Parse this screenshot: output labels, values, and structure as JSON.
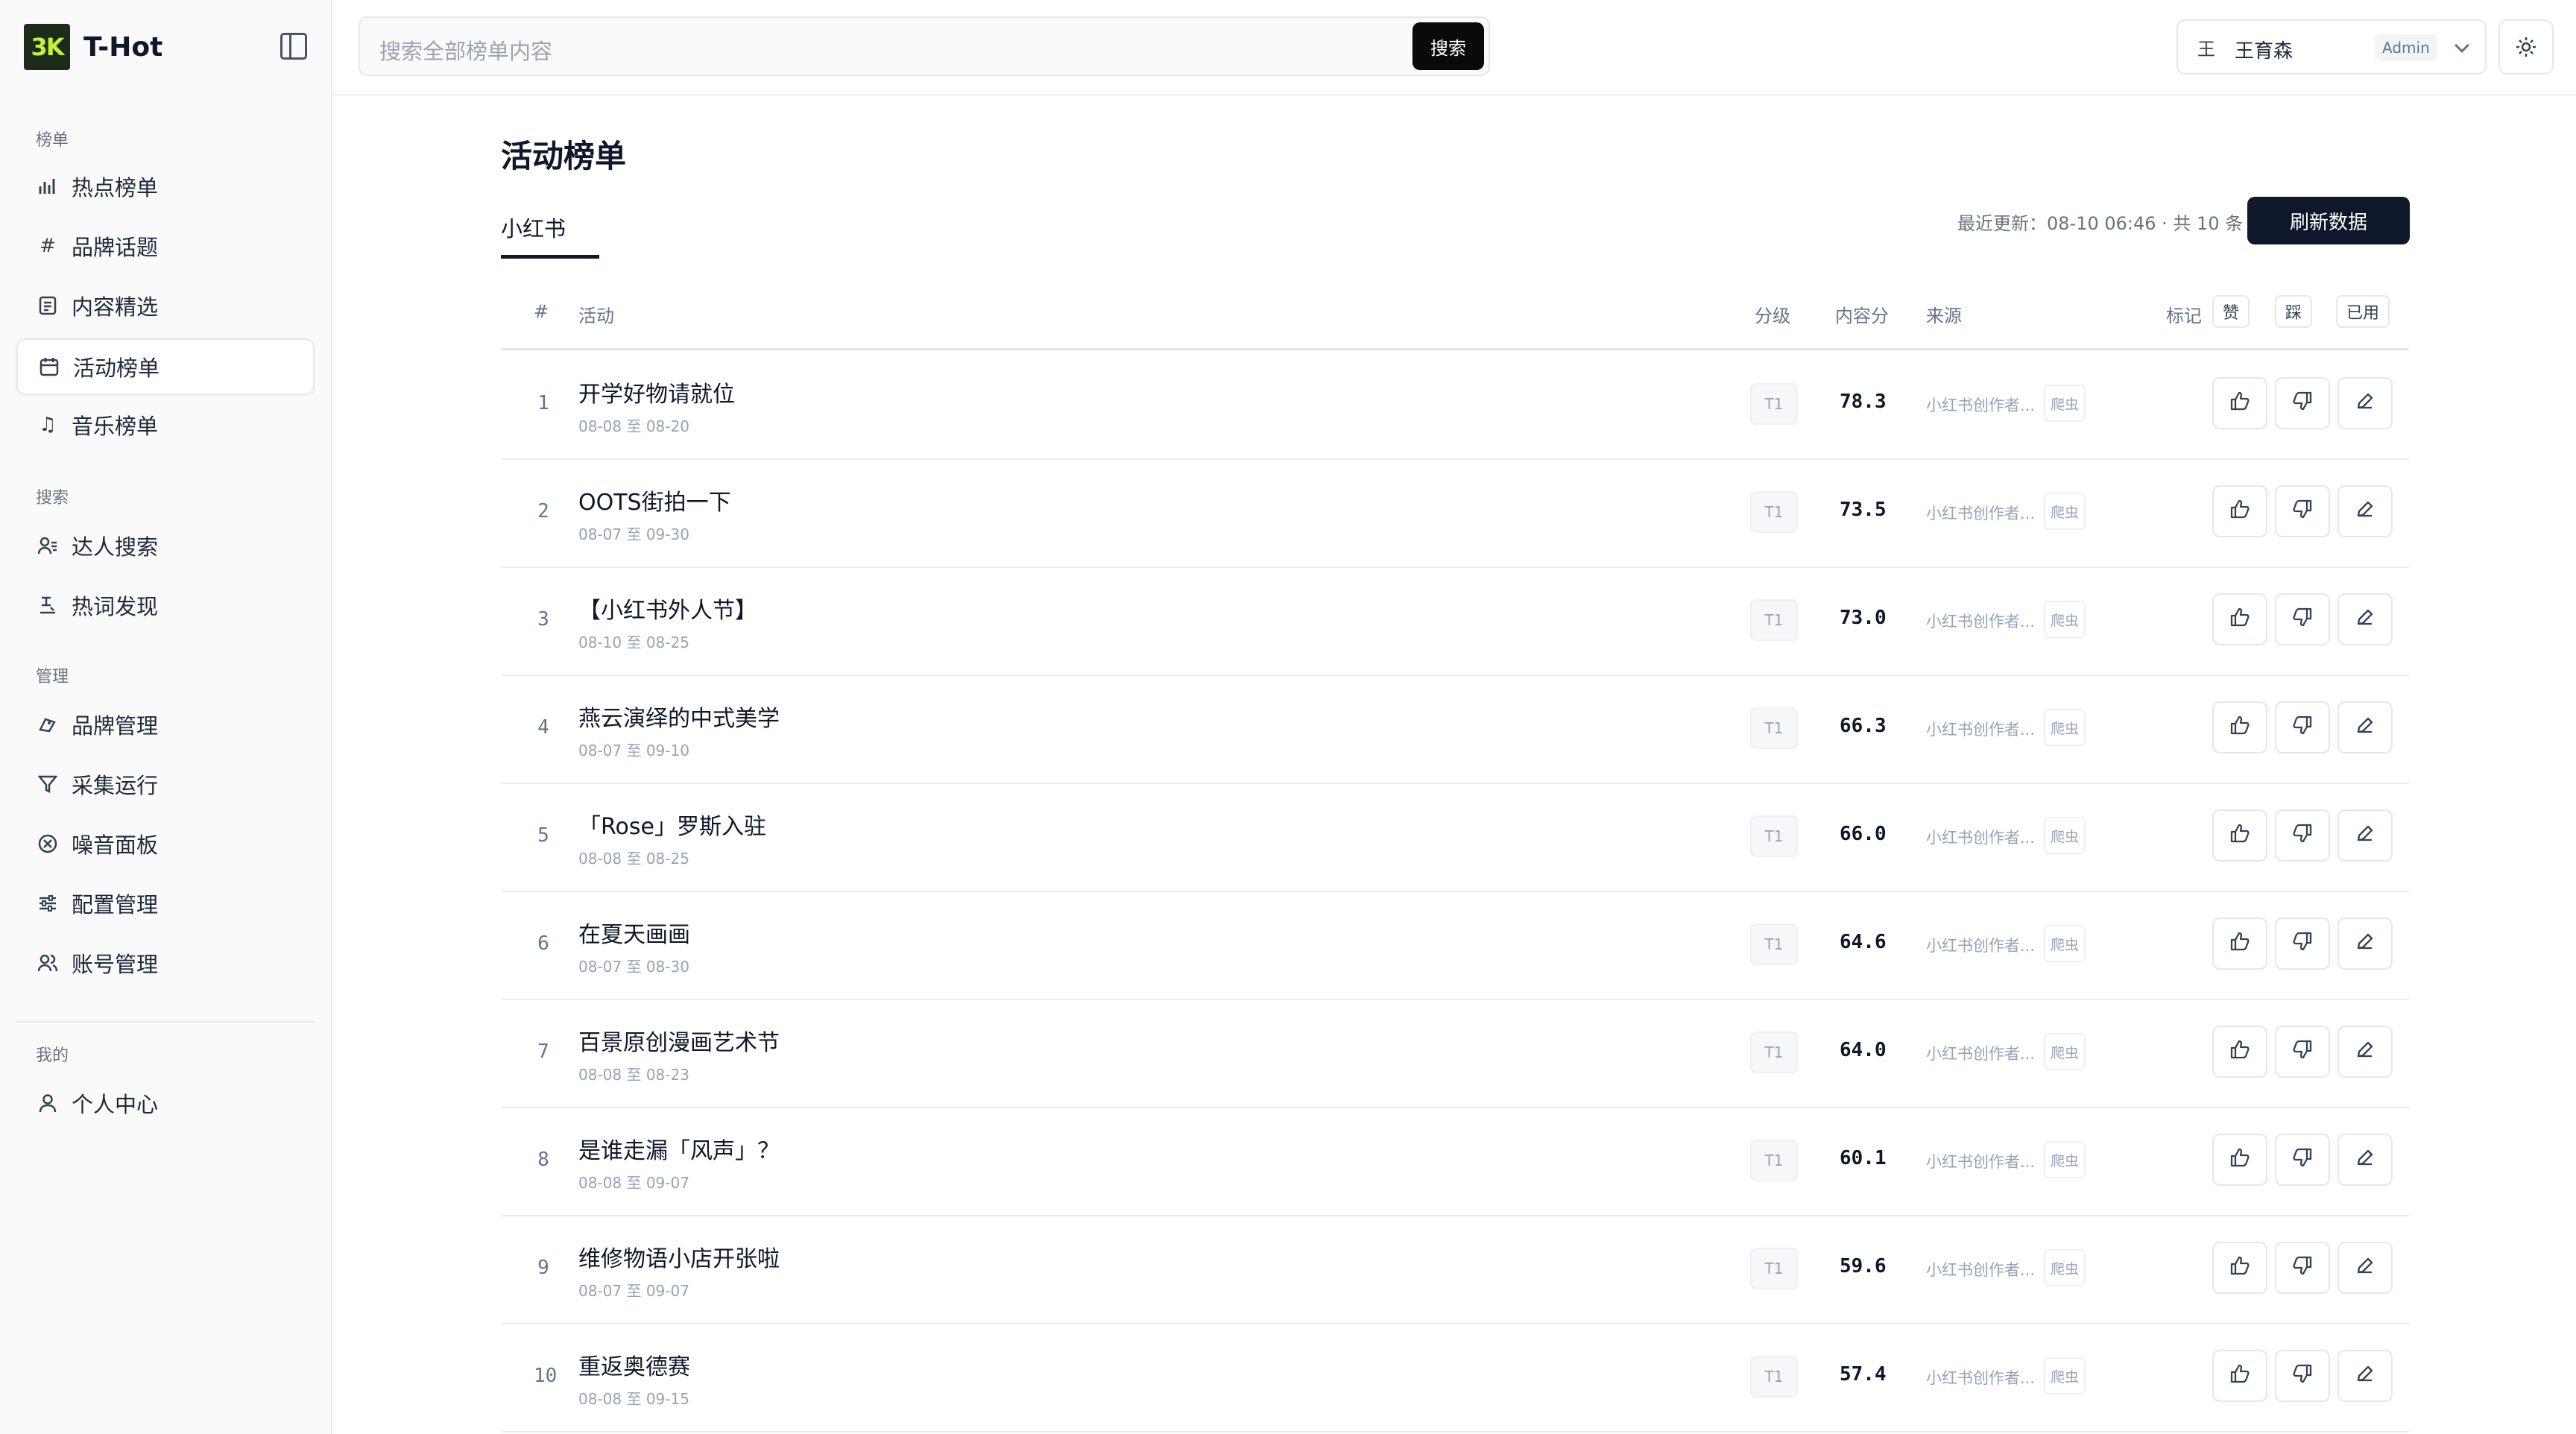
{
  "app": {
    "logo_text": "3K",
    "name": "T-Hot"
  },
  "sidebar": {
    "sections": [
      {
        "title": "榜单",
        "items": [
          {
            "label": "热点榜单",
            "icon": "bar-chart-icon"
          },
          {
            "label": "品牌话题",
            "icon": "hash-icon"
          },
          {
            "label": "内容精选",
            "icon": "document-icon"
          },
          {
            "label": "活动榜单",
            "icon": "calendar-icon",
            "active": true
          },
          {
            "label": "音乐榜单",
            "icon": "music-icon"
          }
        ]
      },
      {
        "title": "搜索",
        "items": [
          {
            "label": "达人搜索",
            "icon": "user-search-icon"
          },
          {
            "label": "热词发现",
            "icon": "keyword-icon"
          }
        ]
      },
      {
        "title": "管理",
        "items": [
          {
            "label": "品牌管理",
            "icon": "brand-icon"
          },
          {
            "label": "采集运行",
            "icon": "filter-icon"
          },
          {
            "label": "噪音面板",
            "icon": "noise-icon"
          },
          {
            "label": "配置管理",
            "icon": "sliders-icon"
          },
          {
            "label": "账号管理",
            "icon": "users-icon"
          }
        ]
      },
      {
        "title": "我的",
        "items": [
          {
            "label": "个人中心",
            "icon": "user-icon"
          }
        ]
      }
    ]
  },
  "search": {
    "placeholder": "搜索全部榜单内容",
    "button": "搜索"
  },
  "user": {
    "avatar": "王",
    "name": "王育森",
    "role": "Admin"
  },
  "page": {
    "title": "活动榜单",
    "tab": "小红书",
    "meta": "最近更新：08-10 06:46 · 共 10 条",
    "refresh": "刷新数据"
  },
  "table": {
    "headers": {
      "index": "#",
      "activity": "活动",
      "level": "分级",
      "score": "内容分",
      "source": "来源",
      "mark": "标记",
      "like": "赞",
      "dislike": "踩",
      "used": "已用"
    },
    "rows": [
      {
        "n": "1",
        "title": "开学好物请就位",
        "date": "08-08 至 08-20",
        "level": "T1",
        "score": "78.3",
        "source": "小红书创作者...",
        "tag": "爬虫"
      },
      {
        "n": "2",
        "title": "OOTS街拍一下",
        "date": "08-07 至 09-30",
        "level": "T1",
        "score": "73.5",
        "source": "小红书创作者...",
        "tag": "爬虫"
      },
      {
        "n": "3",
        "title": "【小红书外人节】",
        "date": "08-10 至 08-25",
        "level": "T1",
        "score": "73.0",
        "source": "小红书创作者...",
        "tag": "爬虫"
      },
      {
        "n": "4",
        "title": "燕云演绎的中式美学",
        "date": "08-07 至 09-10",
        "level": "T1",
        "score": "66.3",
        "source": "小红书创作者...",
        "tag": "爬虫"
      },
      {
        "n": "5",
        "title": "「Rose」罗斯入驻",
        "date": "08-08 至 08-25",
        "level": "T1",
        "score": "66.0",
        "source": "小红书创作者...",
        "tag": "爬虫"
      },
      {
        "n": "6",
        "title": "在夏天画画",
        "date": "08-07 至 08-30",
        "level": "T1",
        "score": "64.6",
        "source": "小红书创作者...",
        "tag": "爬虫"
      },
      {
        "n": "7",
        "title": "百景原创漫画艺术节",
        "date": "08-08 至 08-23",
        "level": "T1",
        "score": "64.0",
        "source": "小红书创作者...",
        "tag": "爬虫"
      },
      {
        "n": "8",
        "title": "是谁走漏「风声」？",
        "date": "08-08 至 09-07",
        "level": "T1",
        "score": "60.1",
        "source": "小红书创作者...",
        "tag": "爬虫"
      },
      {
        "n": "9",
        "title": "维修物语小店开张啦",
        "date": "08-07 至 09-07",
        "level": "T1",
        "score": "59.6",
        "source": "小红书创作者...",
        "tag": "爬虫"
      },
      {
        "n": "10",
        "title": "重返奥德赛",
        "date": "08-08 至 09-15",
        "level": "T1",
        "score": "57.4",
        "source": "小红书创作者...",
        "tag": "爬虫"
      }
    ]
  }
}
